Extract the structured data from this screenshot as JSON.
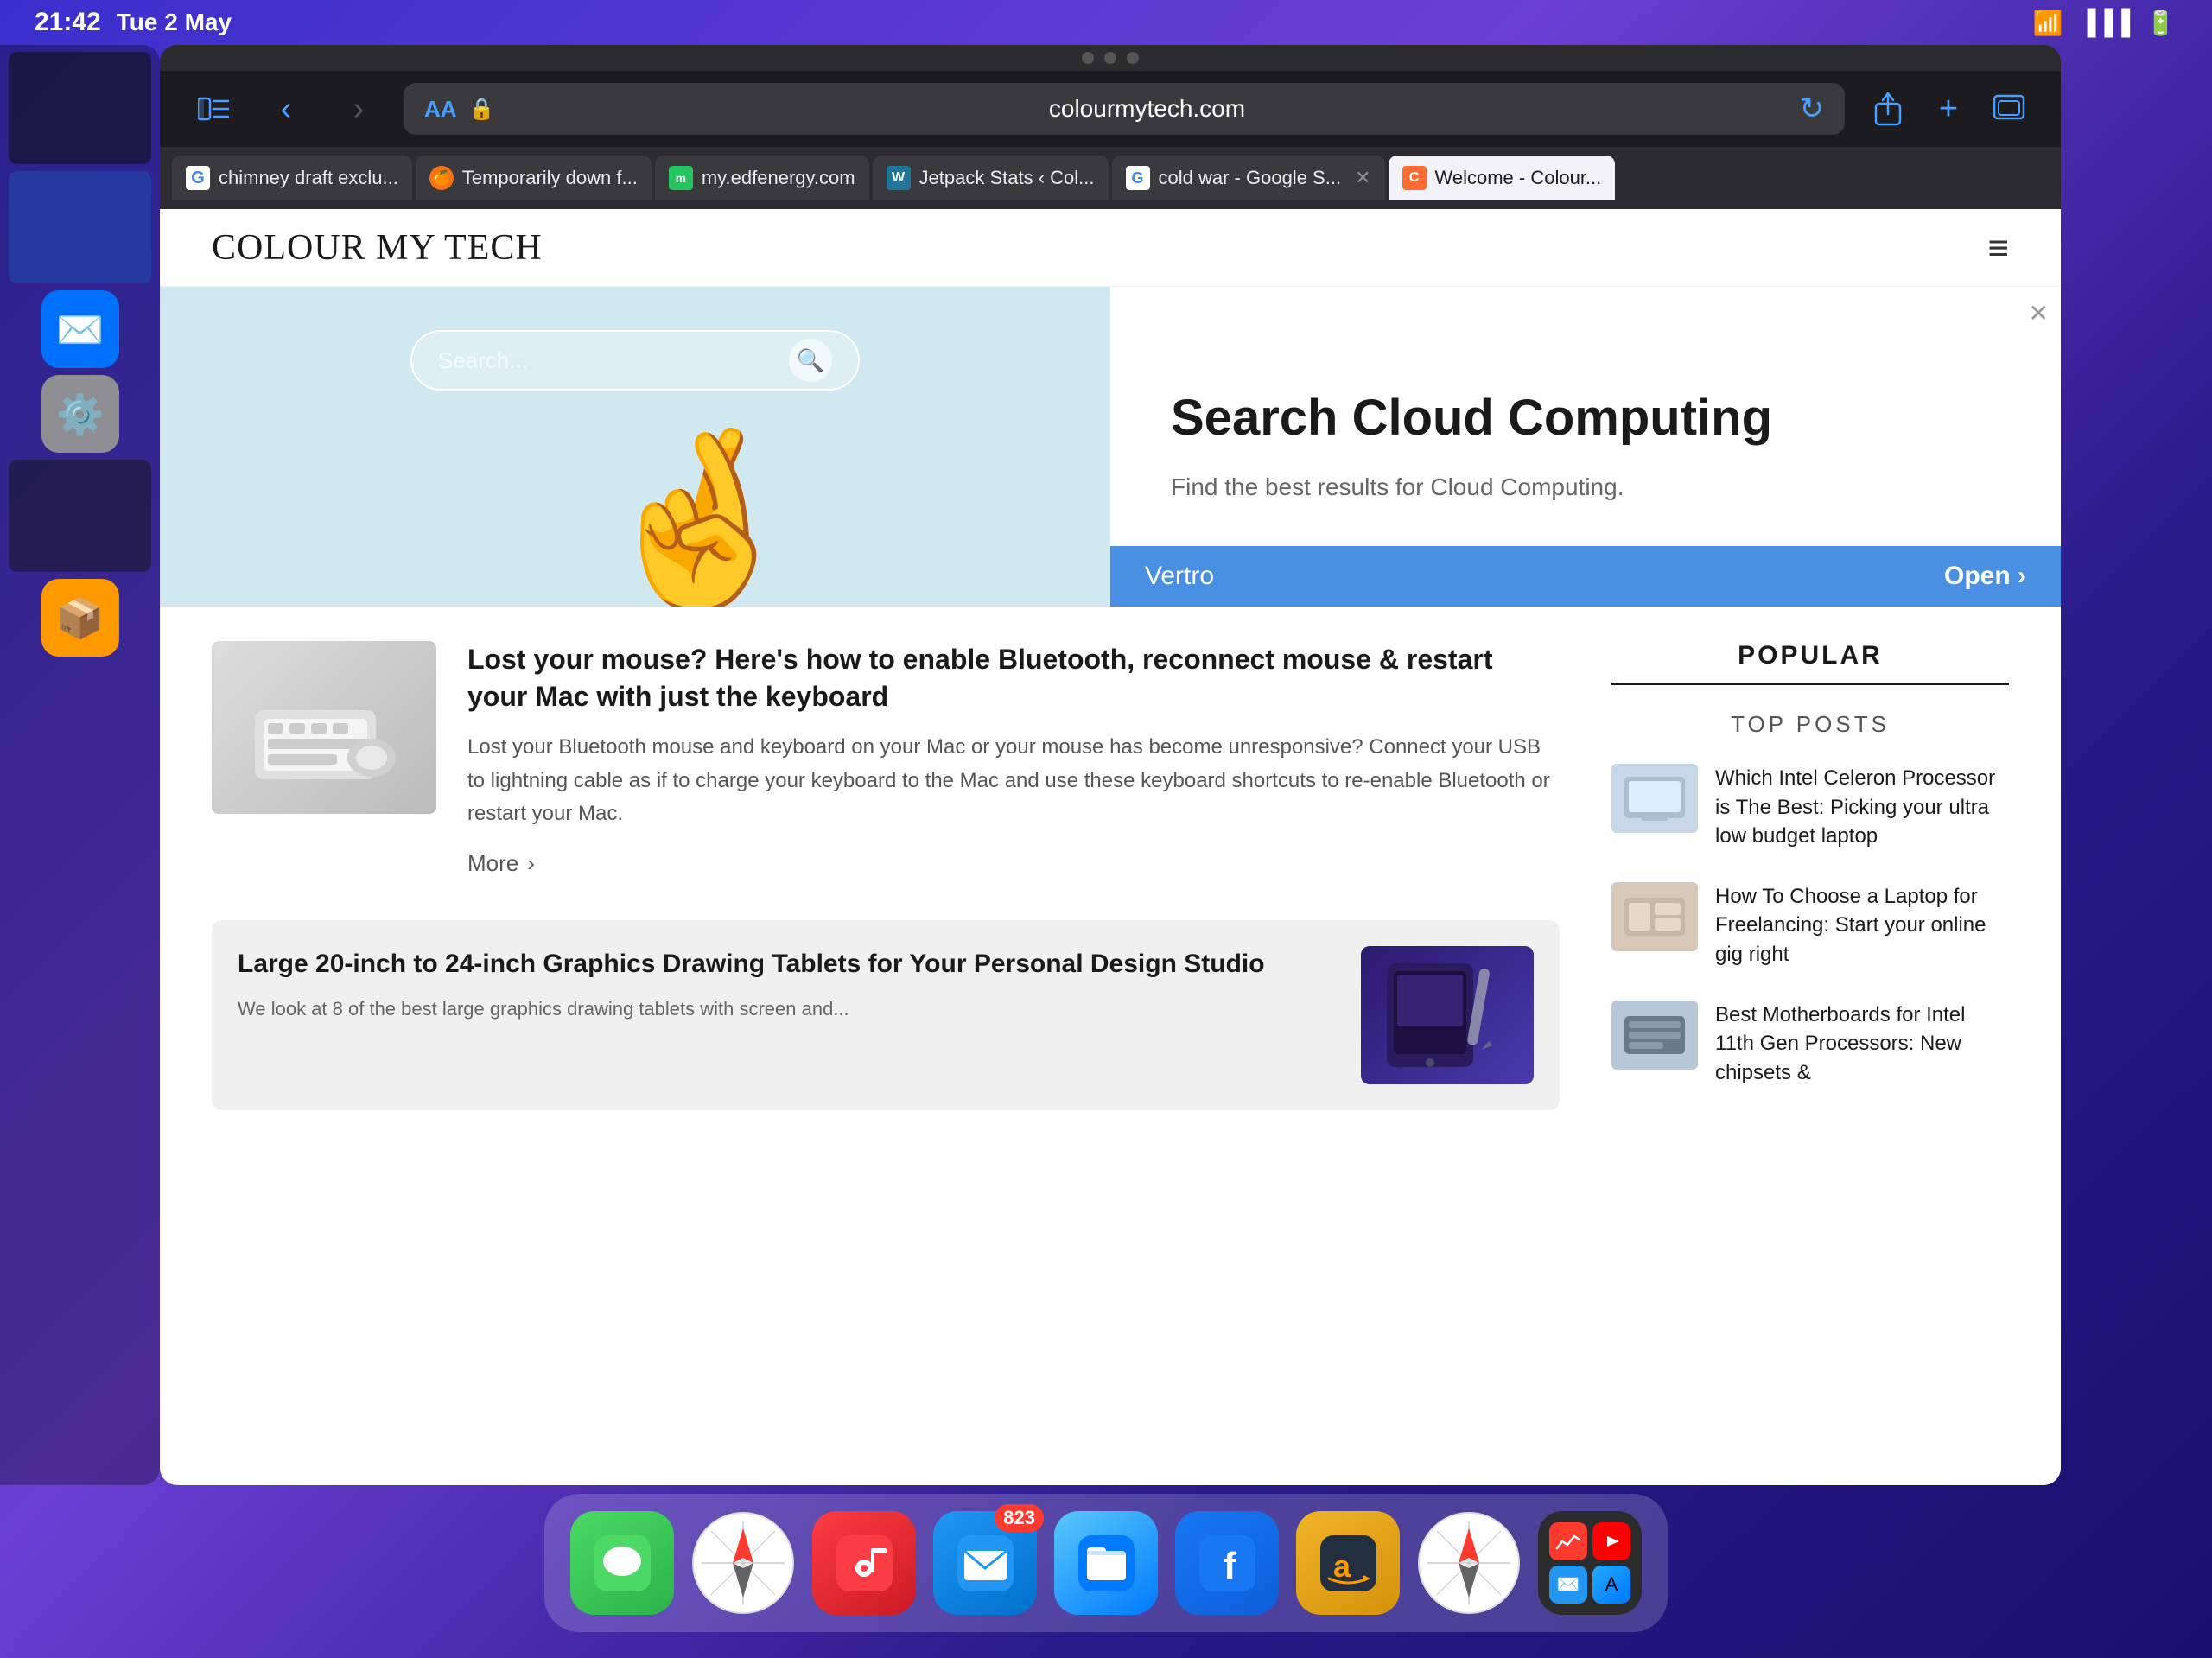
{
  "statusBar": {
    "time": "21:42",
    "date": "Tue 2 May"
  },
  "browser": {
    "urlBar": {
      "aa": "AA",
      "lock": "🔒",
      "url": "colourmytech.com",
      "reload": "↻"
    },
    "tabs": [
      {
        "id": "tab-1",
        "favicon": "G",
        "faviconType": "google",
        "label": "chimney draft exclu...",
        "active": false,
        "closable": false
      },
      {
        "id": "tab-2",
        "favicon": "🍊",
        "faviconType": "orange",
        "label": "Temporarily down f...",
        "active": false,
        "closable": false
      },
      {
        "id": "tab-3",
        "favicon": "m",
        "faviconType": "myedf",
        "label": "my.edfenergy.com",
        "active": false,
        "closable": false
      },
      {
        "id": "tab-4",
        "favicon": "W",
        "faviconType": "wp",
        "label": "Jetpack Stats ‹ Col...",
        "active": false,
        "closable": false
      },
      {
        "id": "tab-5",
        "favicon": "G",
        "faviconType": "google2",
        "label": "cold war - Google S...",
        "active": false,
        "closable": true
      },
      {
        "id": "tab-6",
        "favicon": "C",
        "faviconType": "cmt",
        "label": "Welcome - Colour...",
        "active": true,
        "closable": false
      }
    ]
  },
  "website": {
    "logo": "Colour My Tech",
    "adBanner": {
      "searchPlaceholder": "Search...",
      "adTitle": "Search Cloud Computing",
      "adSubtitle": "Find the best results for Cloud Computing.",
      "advertiser": "Vertro",
      "cta": "Open ›"
    },
    "article": {
      "title": "Lost your mouse? Here's how to enable Bluetooth, reconnect mouse & restart your Mac with just the keyboard",
      "excerpt": "Lost your Bluetooth mouse and keyboard on your Mac or your mouse has become unresponsive? Connect your USB to lightning cable as if to charge your keyboard to the Mac and use these keyboard shortcuts to re-enable Bluetooth or restart your Mac.",
      "moreLabel": "More",
      "moreArrow": "›"
    },
    "promoCard": {
      "title": "Large 20-inch to 24-inch Graphics Drawing Tablets for Your Personal Design Studio",
      "excerpt": "We look at 8 of the best large graphics drawing tablets with screen and..."
    },
    "sidebar": {
      "popularLabel": "POPULAR",
      "topPostsLabel": "TOP POSTS",
      "posts": [
        {
          "id": "post-1",
          "thumb": "💻",
          "thumbBg": "#ccc",
          "title": "Which Intel Celeron Processor is The Best: Picking your ultra low budget laptop"
        },
        {
          "id": "post-2",
          "thumb": "💼",
          "thumbBg": "#bbb",
          "title": "How To Choose a Laptop for Freelancing: Start your online gig right"
        },
        {
          "id": "post-3",
          "thumb": "🖥",
          "thumbBg": "#aaa",
          "title": "Best Motherboards for Intel 11th Gen Processors: New chipsets &"
        }
      ]
    }
  },
  "dock": {
    "icons": [
      {
        "id": "messages",
        "emoji": "💬",
        "bg": "#4cd964",
        "label": "Messages",
        "badge": null
      },
      {
        "id": "safari",
        "emoji": "🧭",
        "bg": "#0070ff",
        "label": "Safari",
        "badge": null
      },
      {
        "id": "music",
        "emoji": "🎵",
        "bg": "#fc3c44",
        "label": "Music",
        "badge": null
      },
      {
        "id": "mail",
        "emoji": "✉️",
        "bg": "#0070ff",
        "label": "Mail",
        "badge": "823"
      },
      {
        "id": "files",
        "emoji": "📁",
        "bg": "#007aff",
        "label": "Files",
        "badge": null
      },
      {
        "id": "facebook",
        "emoji": "f",
        "bg": "#1877f2",
        "label": "Facebook",
        "badge": null
      },
      {
        "id": "amazon",
        "emoji": "📦",
        "bg": "#f90",
        "label": "Amazon",
        "badge": null
      },
      {
        "id": "safari2",
        "emoji": "🧭",
        "bg": "#007aff",
        "label": "Safari 2",
        "badge": null
      },
      {
        "id": "apps",
        "emoji": "⊞",
        "bg": "#2c2c2e",
        "label": "App Grid",
        "badge": null
      }
    ]
  }
}
